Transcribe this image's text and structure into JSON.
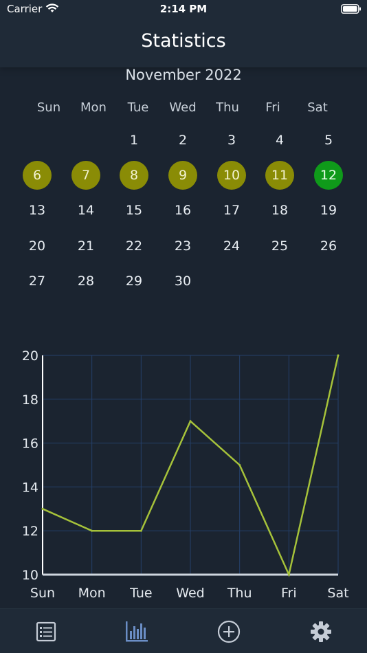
{
  "status_bar": {
    "carrier": "Carrier",
    "time": "2:14 PM"
  },
  "nav": {
    "title": "Statistics"
  },
  "calendar": {
    "month": "November 2022",
    "weekdays": [
      "Sun",
      "Mon",
      "Tue",
      "Wed",
      "Thu",
      "Fri",
      "Sat"
    ],
    "days": [
      {
        "label": "1",
        "row": 0,
        "col": 2
      },
      {
        "label": "2",
        "row": 0,
        "col": 3
      },
      {
        "label": "3",
        "row": 0,
        "col": 4
      },
      {
        "label": "4",
        "row": 0,
        "col": 5
      },
      {
        "label": "5",
        "row": 0,
        "col": 6
      },
      {
        "label": "6",
        "row": 1,
        "col": 0,
        "state": "highlight"
      },
      {
        "label": "7",
        "row": 1,
        "col": 1,
        "state": "highlight"
      },
      {
        "label": "8",
        "row": 1,
        "col": 2,
        "state": "highlight"
      },
      {
        "label": "9",
        "row": 1,
        "col": 3,
        "state": "highlight"
      },
      {
        "label": "10",
        "row": 1,
        "col": 4,
        "state": "highlight"
      },
      {
        "label": "11",
        "row": 1,
        "col": 5,
        "state": "highlight"
      },
      {
        "label": "12",
        "row": 1,
        "col": 6,
        "state": "today"
      },
      {
        "label": "13",
        "row": 2,
        "col": 0
      },
      {
        "label": "14",
        "row": 2,
        "col": 1
      },
      {
        "label": "15",
        "row": 2,
        "col": 2
      },
      {
        "label": "16",
        "row": 2,
        "col": 3
      },
      {
        "label": "17",
        "row": 2,
        "col": 4
      },
      {
        "label": "18",
        "row": 2,
        "col": 5
      },
      {
        "label": "19",
        "row": 2,
        "col": 6
      },
      {
        "label": "20",
        "row": 3,
        "col": 0
      },
      {
        "label": "21",
        "row": 3,
        "col": 1
      },
      {
        "label": "22",
        "row": 3,
        "col": 2
      },
      {
        "label": "23",
        "row": 3,
        "col": 3
      },
      {
        "label": "24",
        "row": 3,
        "col": 4
      },
      {
        "label": "25",
        "row": 3,
        "col": 5
      },
      {
        "label": "26",
        "row": 3,
        "col": 6
      },
      {
        "label": "27",
        "row": 4,
        "col": 0
      },
      {
        "label": "28",
        "row": 4,
        "col": 1
      },
      {
        "label": "29",
        "row": 4,
        "col": 2
      },
      {
        "label": "30",
        "row": 4,
        "col": 3
      }
    ]
  },
  "chart_data": {
    "type": "line",
    "categories": [
      "Sun",
      "Mon",
      "Tue",
      "Wed",
      "Thu",
      "Fri",
      "Sat"
    ],
    "values": [
      13,
      12,
      12,
      17,
      15,
      10,
      20
    ],
    "ylim": [
      10,
      20
    ],
    "yticks": [
      10,
      12,
      14,
      16,
      18,
      20
    ],
    "grid": true,
    "line_color": "#a6c23a"
  },
  "tabbar": {
    "tabs": [
      {
        "name": "list-icon"
      },
      {
        "name": "bar-chart-icon"
      },
      {
        "name": "add-circle-icon"
      },
      {
        "name": "gear-icon"
      }
    ]
  },
  "colors": {
    "background": "#1b2430",
    "highlight_day": "#8a8c06",
    "today": "#0f9a1a",
    "accent_tab": "#6b8ec6"
  }
}
